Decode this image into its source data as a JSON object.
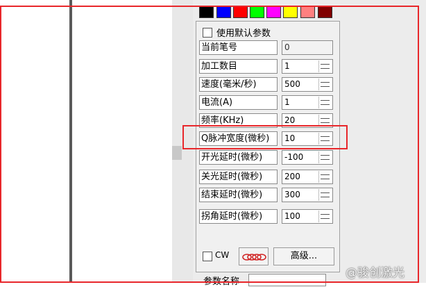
{
  "colors": {
    "palette": [
      "#000000",
      "#0000ff",
      "#ff0000",
      "#00ff00",
      "#ff00ff",
      "#ffff00",
      "#ff8080",
      "#800000"
    ],
    "highlight_frame": "#e8272b"
  },
  "panel": {
    "use_default_label": "使用默认参数",
    "current_pen_label": "当前笔号",
    "current_pen_value": "0",
    "fields": [
      {
        "label": "加工数目",
        "value": "1"
      },
      {
        "label": "速度(毫米/秒)",
        "value": "500"
      },
      {
        "label": "电流(A)",
        "value": "1"
      },
      {
        "label": "频率(KHz)",
        "value": "20"
      },
      {
        "label": "Q脉冲宽度(微秒)",
        "value": "10"
      },
      {
        "label": "开光延时(微秒)",
        "value": "-100"
      },
      {
        "label": "关光延时(微秒)",
        "value": "200"
      },
      {
        "label": "结束延时(微秒)",
        "value": "300"
      },
      {
        "label": "拐角延时(微秒)",
        "value": "100"
      }
    ],
    "cw_label": "CW",
    "advanced_button": "高级...",
    "bottom_partial_label": "参数名称"
  },
  "watermark": "@骏创激光"
}
